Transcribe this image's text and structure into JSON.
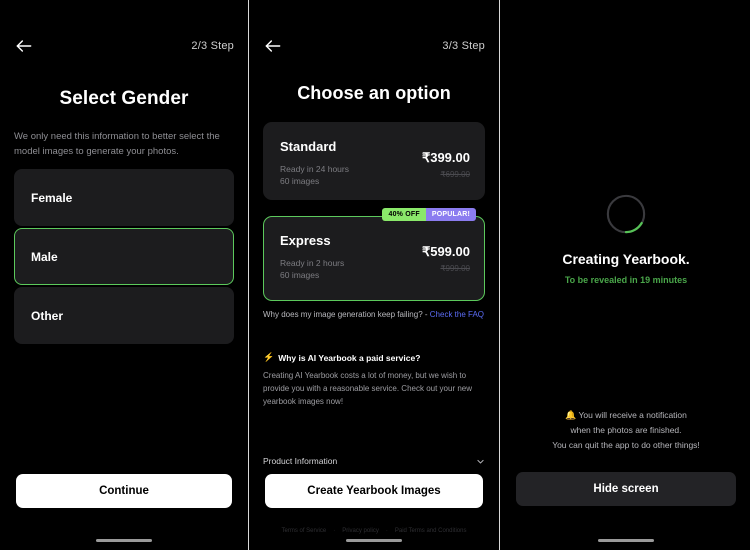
{
  "colors": {
    "background": "#000000",
    "card": "#1c1c1e",
    "accent_green": "#5cc95c",
    "badge_green": "#8ae86a",
    "badge_purple": "#8b7cf0",
    "link_blue": "#5b6cf5",
    "reveal_green": "#4aa64a"
  },
  "screen_gender": {
    "back_icon": "back-arrow-icon",
    "step": "2/3 Step",
    "title": "Select Gender",
    "subtitle": "We only need this information to better select the model images to generate your photos.",
    "options": [
      {
        "label": "Female",
        "selected": false
      },
      {
        "label": "Male",
        "selected": true
      },
      {
        "label": "Other",
        "selected": false
      }
    ],
    "continue_label": "Continue"
  },
  "screen_option": {
    "back_icon": "back-arrow-icon",
    "step": "3/3 Step",
    "title": "Choose an option",
    "plans": [
      {
        "name": "Standard",
        "ready": "Ready in 24 hours",
        "images": "60 images",
        "price": "₹399.00",
        "old_price": "₹699.00",
        "selected": false,
        "badges": []
      },
      {
        "name": "Express",
        "ready": "Ready in 2 hours",
        "images": "60 images",
        "price": "₹599.00",
        "old_price": "₹999.00",
        "selected": true,
        "badges": [
          {
            "text": "40% OFF",
            "style": "green"
          },
          {
            "text": "POPULAR!",
            "style": "purple"
          }
        ]
      }
    ],
    "faq_question": "Why does my image generation keep failing? - ",
    "faq_link": "Check the FAQ",
    "paid_icon": "bolt-icon",
    "paid_heading": "Why is AI Yearbook a paid service?",
    "paid_body": "Creating AI Yearbook costs a lot of money, but we wish to provide you with a reasonable service. Check out your new yearbook images now!",
    "product_info_label": "Product Information",
    "product_info_icon": "chevron-down-icon",
    "create_label": "Create Yearbook Images",
    "footer_links": [
      "Terms of Service",
      "Privacy policy",
      "Paid Terms and Conditions"
    ],
    "footer_separator": "·"
  },
  "screen_creating": {
    "spinner_icon": "loading-spinner-icon",
    "title": "Creating Yearbook.",
    "reveal": "To be revealed in 19 minutes",
    "bell_icon": "bell-icon",
    "notify_line1": "You will receive a notification",
    "notify_line2": "when the photos are finished.",
    "notify_line3": "You can quit the app to do other things!",
    "hide_label": "Hide screen"
  }
}
